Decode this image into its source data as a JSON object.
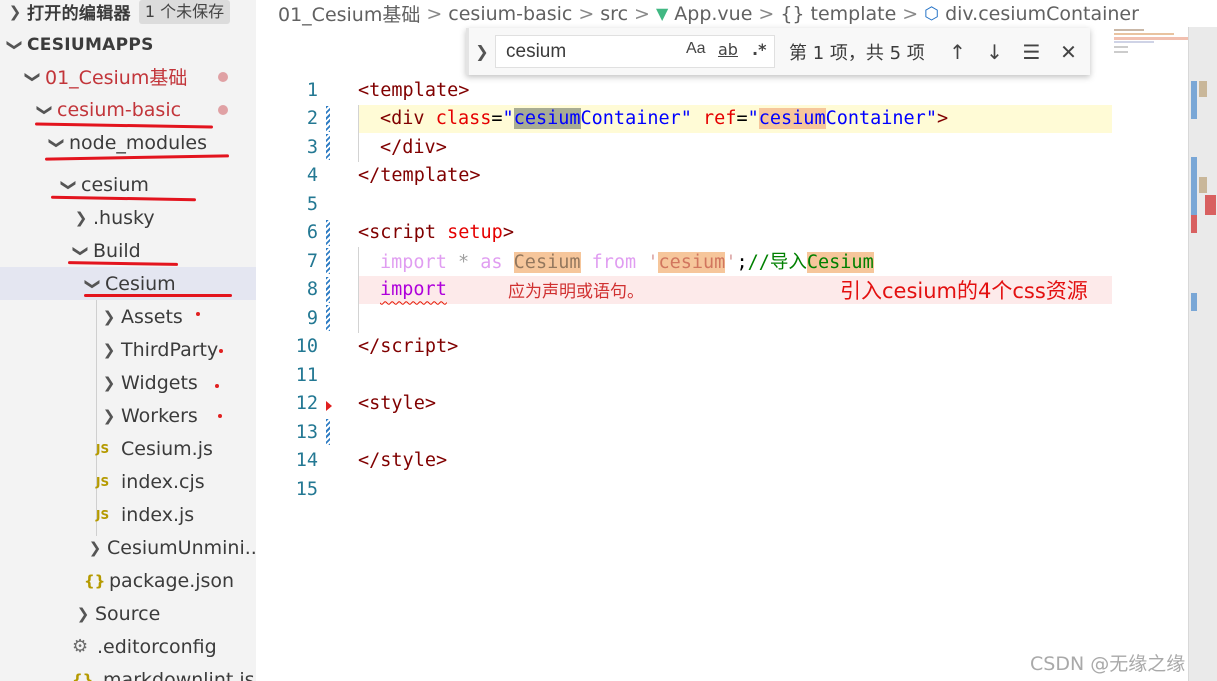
{
  "explorer": {
    "open_editors": {
      "label": "打开的编辑器",
      "unsaved_badge": "1 个未保存"
    },
    "project": "CESIUMAPPS",
    "tree": [
      {
        "label": "01_Cesium基础"
      },
      {
        "label": "cesium-basic"
      },
      {
        "label": "node_modules"
      },
      {
        "label": "cesium"
      },
      {
        "label": ".husky"
      },
      {
        "label": "Build"
      },
      {
        "label": "Cesium"
      },
      {
        "label": "Assets"
      },
      {
        "label": "ThirdParty"
      },
      {
        "label": "Widgets"
      },
      {
        "label": "Workers"
      },
      {
        "label": "Cesium.js",
        "icon": "JS"
      },
      {
        "label": "index.cjs",
        "icon": "JS"
      },
      {
        "label": "index.js",
        "icon": "JS"
      },
      {
        "label": "CesiumUnmini..."
      },
      {
        "label": "package.json",
        "icon": "{}"
      },
      {
        "label": "Source"
      },
      {
        "label": ".editorconfig"
      },
      {
        "label": ".markdownlint.js",
        "icon": "{}"
      }
    ]
  },
  "breadcrumb": {
    "items": [
      "01_Cesium基础",
      "cesium-basic",
      "src",
      "App.vue",
      "template",
      "div.cesiumContainer"
    ],
    "separator": ">"
  },
  "find": {
    "query": "cesium",
    "match_case": "Aa",
    "whole_word": "ab",
    "regex": ".*",
    "count": "第 1 项，共 5 项"
  },
  "editor": {
    "line_numbers": [
      "1",
      "2",
      "3",
      "4",
      "5",
      "6",
      "7",
      "8",
      "9",
      "10",
      "11",
      "12",
      "13",
      "14",
      "15"
    ],
    "l1": {
      "open": "<",
      "tag": "template",
      "close": ">"
    },
    "l2": {
      "open": "<",
      "tag": "div",
      "attr1": "class",
      "eq1": "=",
      "q1": "\"",
      "m1": "cesium",
      "s1": "Container",
      "q2": "\"",
      "attr2": "ref",
      "eq2": "=",
      "q3": "\"",
      "m2": "cesium",
      "s2": "Container",
      "q4": "\"",
      "close": ">"
    },
    "l3": {
      "open": "</",
      "tag": "div",
      "close": ">"
    },
    "l4": {
      "open": "</",
      "tag": "template",
      "close": ">"
    },
    "l6": {
      "open": "<",
      "tag": "script",
      "attr": "setup",
      "close": ">"
    },
    "l7": {
      "kw_import": "import",
      "star": "*",
      "kw_as": "as",
      "ident": "Cesium",
      "kw_from": "from",
      "q": "'",
      "str": "cesium",
      "q2": "'",
      "semi": ";",
      "comment": "//导入",
      "comment_m": "Cesium"
    },
    "l8": {
      "kw_import": "import",
      "error": "应为声明或语句。",
      "annotation": "引入cesium的4个css资源"
    },
    "l10": {
      "open": "</",
      "tag": "script",
      "close": ">"
    },
    "l12": {
      "open": "<",
      "tag": "style",
      "close": ">"
    },
    "l14": {
      "open": "</",
      "tag": "style",
      "close": ">"
    }
  },
  "watermark": "CSDN @无缘之缘"
}
